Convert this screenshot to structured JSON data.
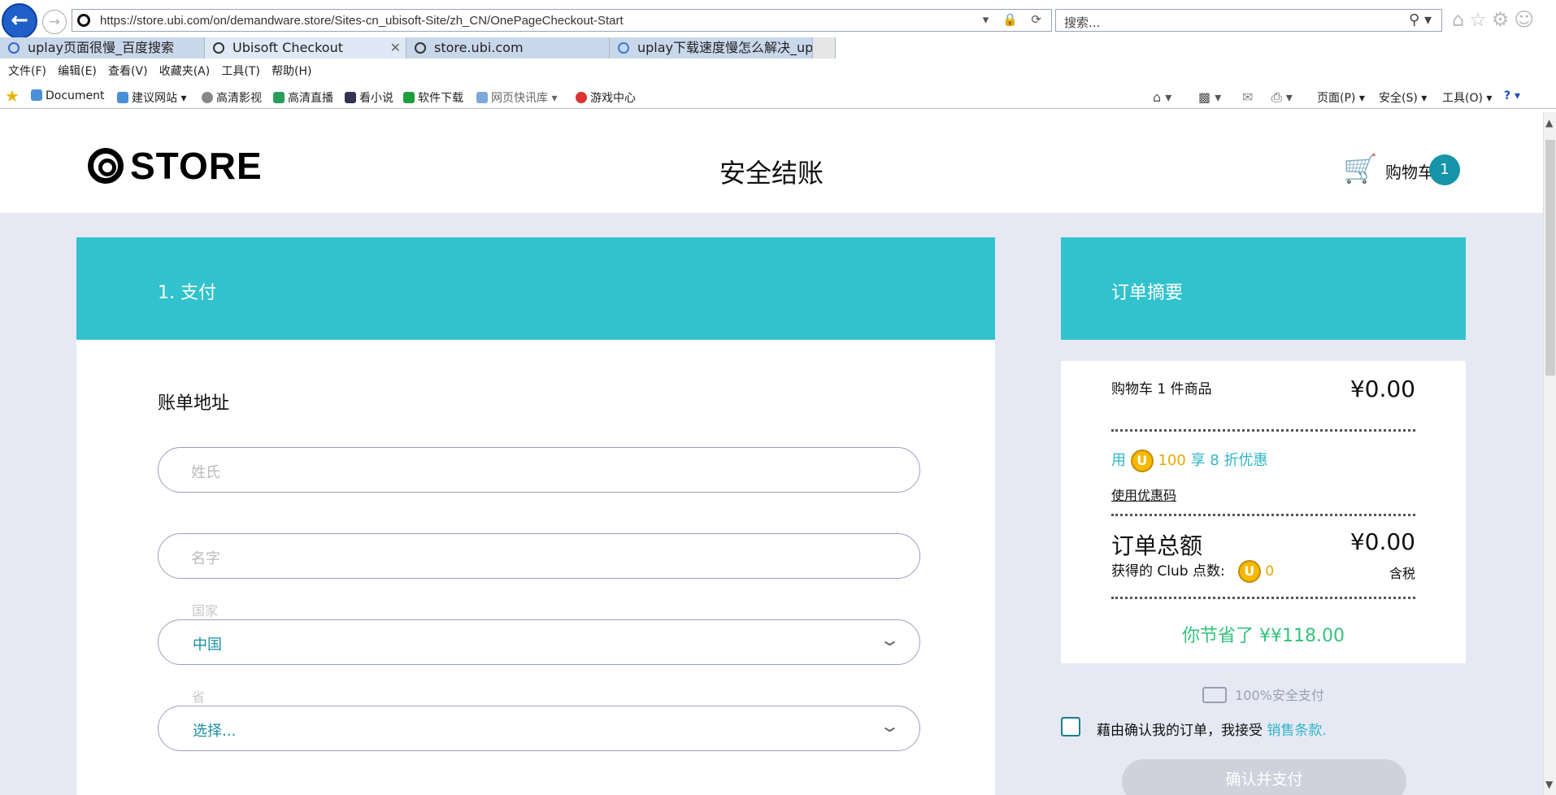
{
  "browser": {
    "url": "https://store.ubi.com/on/demandware.store/Sites-cn_ubisoft-Site/zh_CN/OnePageCheckout-Start",
    "search_placeholder": "搜索...",
    "tabs": [
      {
        "label": "uplay页面很慢_百度搜索",
        "active": false
      },
      {
        "label": "Ubisoft Checkout",
        "active": true
      },
      {
        "label": "store.ubi.com",
        "active": false
      },
      {
        "label": "uplay下载速度慢怎么解决_up...",
        "active": false
      }
    ],
    "menu": [
      "文件(F)",
      "编辑(E)",
      "查看(V)",
      "收藏夹(A)",
      "工具(T)",
      "帮助(H)"
    ],
    "favorites": [
      "Document",
      "建议网站 ▾",
      "高清影视",
      "高清直播",
      "看小说",
      "软件下载",
      "网页快讯库 ▾",
      "游戏中心"
    ],
    "commands": [
      "页面(P) ▾",
      "安全(S) ▾",
      "工具(O) ▾"
    ]
  },
  "header": {
    "logo_text": "STORE",
    "title": "安全结账",
    "cart_label": "购物车",
    "cart_count": "1"
  },
  "payment": {
    "section_title": "1. 支付",
    "billing_title": "账单地址",
    "last_name_placeholder": "姓氏",
    "first_name_placeholder": "名字",
    "country_label": "国家",
    "country_value": "中国",
    "province_label": "省",
    "province_value": "选择..."
  },
  "summary": {
    "title": "订单摘要",
    "cart_items": "购物车 1 件商品",
    "cart_price": "¥0.00",
    "discount_prefix": "用",
    "discount_points": "100",
    "discount_suffix": "享 8 折优惠",
    "coupon_link": "使用优惠码",
    "total_label": "订单总额",
    "total_price": "¥0.00",
    "club_label": "获得的 Club 点数:",
    "club_points": "0",
    "tax_label": "含税",
    "savings": "你节省了 ¥¥118.00"
  },
  "checkout": {
    "secure_label": "100%安全支付",
    "terms_text": "藉由确认我的订单，我接受",
    "terms_link": "销售条款.",
    "confirm_button": "确认并支付"
  },
  "colors": {
    "accent": "#32c2cd",
    "badge": "#1595a7",
    "savings": "#34c27c",
    "coin": "#f5b900"
  }
}
